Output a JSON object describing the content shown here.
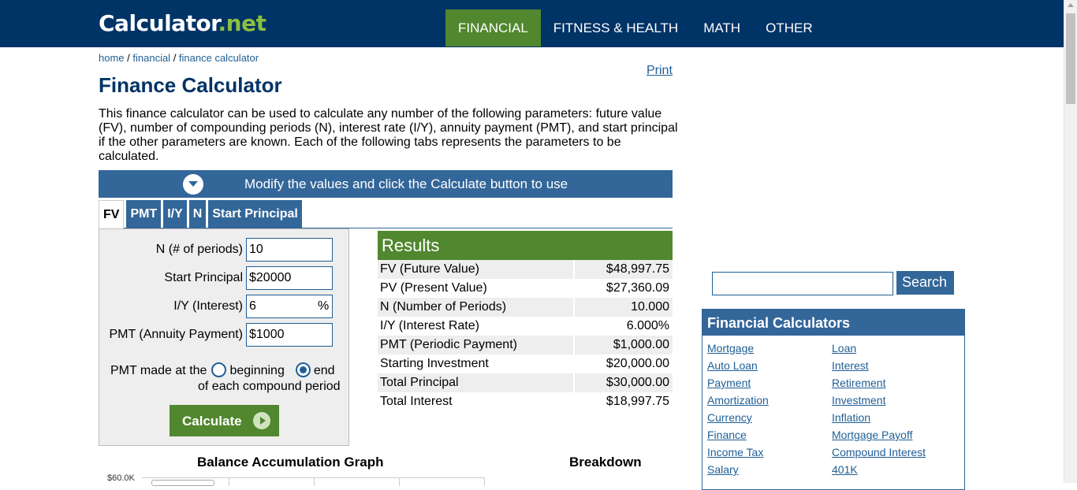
{
  "header": {
    "logo_main": "Calculator",
    "logo_dot": ".",
    "logo_net": "net",
    "nav": [
      "FINANCIAL",
      "FITNESS & HEALTH",
      "MATH",
      "OTHER"
    ]
  },
  "breadcrumb": {
    "home": "home",
    "sep": " / ",
    "financial": "financial",
    "current": "finance calculator"
  },
  "print_label": "Print",
  "title": "Finance Calculator",
  "intro": "This finance calculator can be used to calculate any number of the following parameters: future value (FV), number of compounding periods (N), interest rate (I/Y), annuity payment (PMT), and start principal if the other parameters are known. Each of the following tabs represents the parameters to be calculated.",
  "banner": "Modify the values and click the Calculate button to use",
  "tabs": [
    "FV",
    "PMT",
    "I/Y",
    "N",
    "Start Principal"
  ],
  "form": {
    "n_label": "N (# of periods)",
    "n_value": "10",
    "sp_label": "Start Principal",
    "sp_value": "$20000",
    "iy_label": "I/Y (Interest)",
    "iy_value": "6",
    "iy_suffix": "%",
    "pmt_label": "PMT (Annuity Payment)",
    "pmt_value": "$1000",
    "pmt_made_prefix": "PMT made at the",
    "beginning": "beginning",
    "end": "end",
    "pmt_made_suffix": "of each compound period",
    "calculate": "Calculate"
  },
  "results": {
    "title": "Results",
    "rows": [
      {
        "label": "FV (Future Value)",
        "value": "$48,997.75"
      },
      {
        "label": "PV (Present Value)",
        "value": "$27,360.09"
      },
      {
        "label": "N (Number of Periods)",
        "value": "10.000"
      },
      {
        "label": "I/Y (Interest Rate)",
        "value": "6.000%"
      },
      {
        "label": "PMT (Periodic Payment)",
        "value": "$1,000.00"
      },
      {
        "label": "Starting Investment",
        "value": "$20,000.00"
      },
      {
        "label": "Total Principal",
        "value": "$30,000.00"
      },
      {
        "label": "Total Interest",
        "value": "$18,997.75"
      }
    ]
  },
  "graph_title": "Balance Accumulation Graph",
  "breakdown_title": "Breakdown",
  "graph_y_tick": "$60.0K",
  "search_button": "Search",
  "sidebar": {
    "title": "Financial Calculators",
    "left": [
      "Mortgage",
      "Auto Loan",
      "Payment",
      "Amortization",
      "Currency",
      "Finance",
      "Income Tax",
      "Salary"
    ],
    "right": [
      "Loan",
      "Interest",
      "Retirement",
      "Investment",
      "Inflation",
      "Mortgage Payoff",
      "Compound Interest",
      "401K"
    ]
  },
  "colors": {
    "header_bg": "#003366",
    "accent_green": "#51872e",
    "accent_blue": "#336699",
    "link": "#1f5e95"
  }
}
